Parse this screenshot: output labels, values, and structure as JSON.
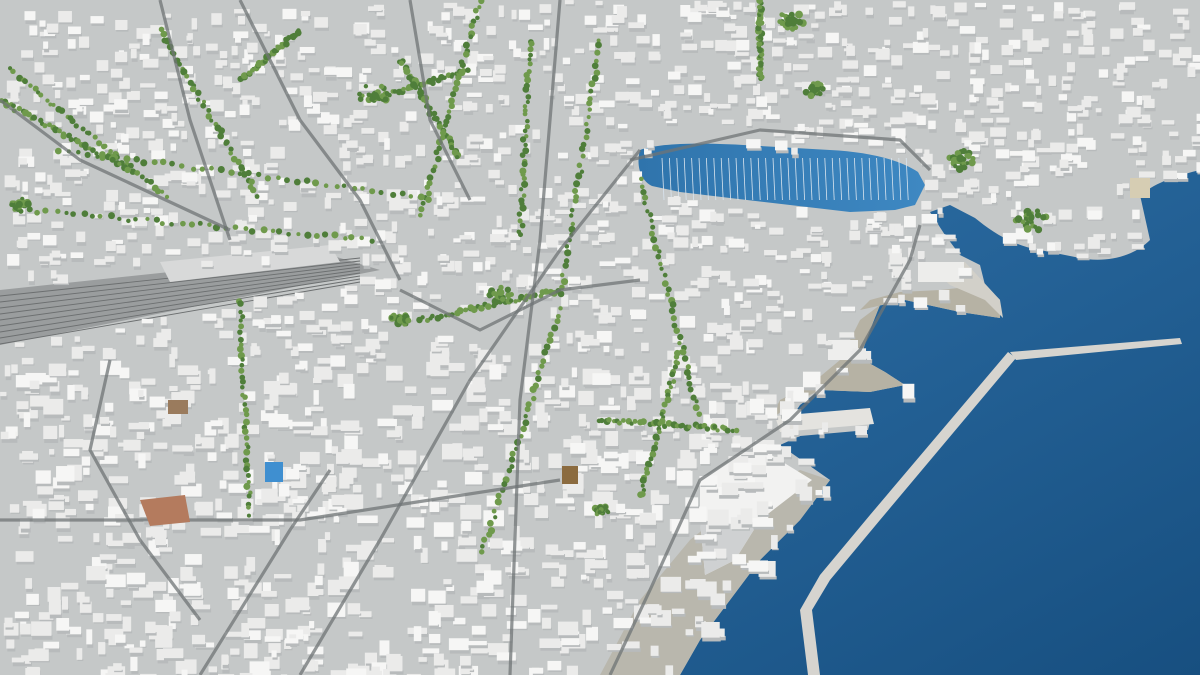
{
  "scene": {
    "kind": "aerial-3d-city-model",
    "text_labels": []
  },
  "palette": {
    "sea_deep": "#1b5a8f",
    "sea_light": "#3f86c0",
    "harbor_water": "#2f76ae",
    "land": "#c9cbca",
    "land_shadow": "#9ea2a3",
    "building": "#ebebea",
    "building_roof": "#f6f6f5",
    "building_shadow": "#b8bbbc",
    "road": "#6f7476",
    "road_light": "#8a8f91",
    "rail": "#7c7f80",
    "park": "#4f7e3a",
    "park_light": "#6f9a4c",
    "quay": "#b6b2a4",
    "pier": "#d6d4cf",
    "clay": "#b47b5e",
    "pool": "#3f8fd0"
  }
}
